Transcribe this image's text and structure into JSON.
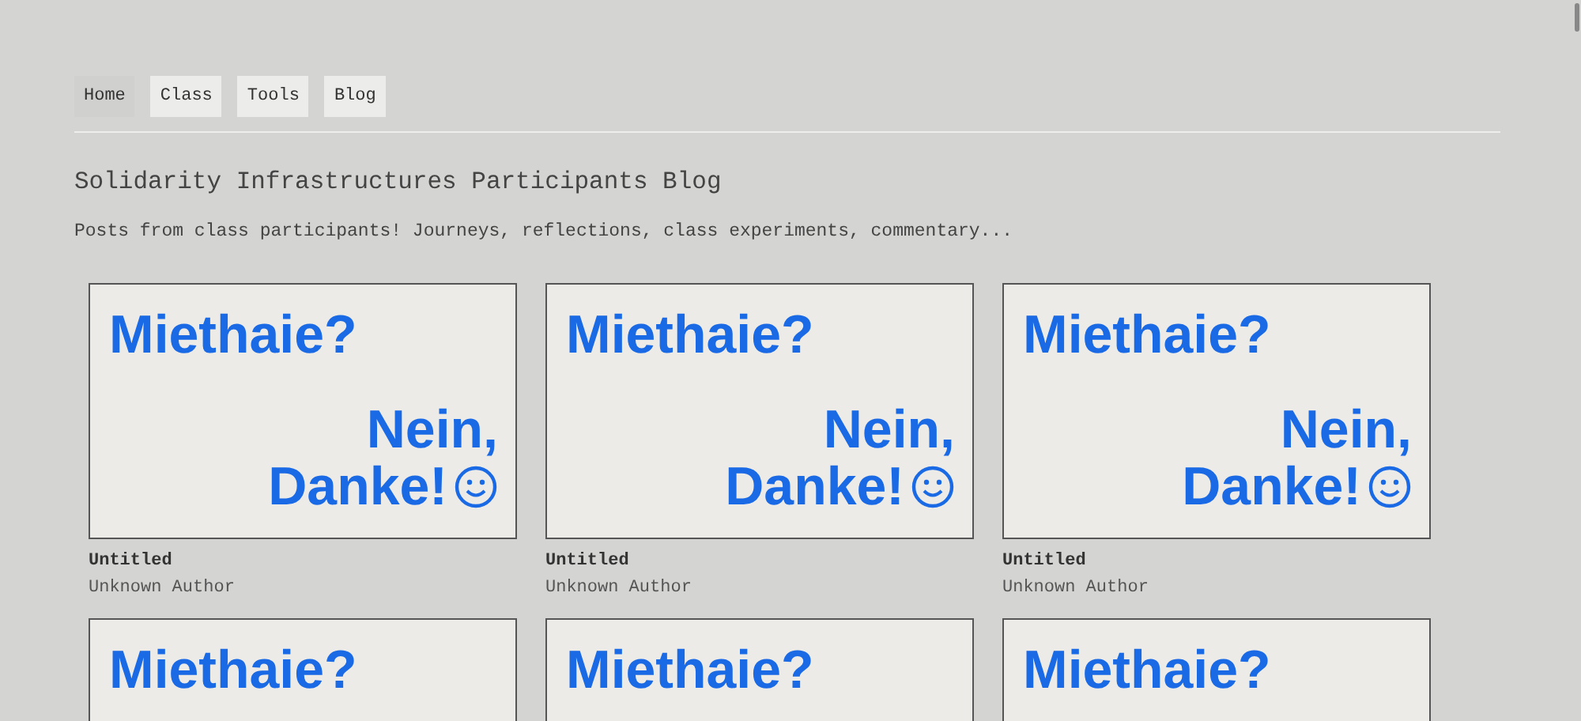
{
  "nav": [
    {
      "label": "Home",
      "selected": true
    },
    {
      "label": "Class",
      "selected": false
    },
    {
      "label": "Tools",
      "selected": false
    },
    {
      "label": "Blog",
      "selected": false
    }
  ],
  "title": "Solidarity Infrastructures Participants Blog",
  "subtitle": "Posts from class participants! Journeys, reflections, class experiments, commentary...",
  "posts": [
    {
      "poster": [
        "Miethaie?",
        "Nein,",
        "Danke!"
      ],
      "title": "Untitled",
      "author": "Unknown Author"
    },
    {
      "poster": [
        "Miethaie?",
        "Nein,",
        "Danke!"
      ],
      "title": "Untitled",
      "author": "Unknown Author"
    },
    {
      "poster": [
        "Miethaie?",
        "Nein,",
        "Danke!"
      ],
      "title": "Untitled",
      "author": "Unknown Author"
    },
    {
      "poster": [
        "Miethaie?"
      ]
    },
    {
      "poster": [
        "Miethaie?"
      ]
    },
    {
      "poster": [
        "Miethaie?"
      ]
    }
  ]
}
